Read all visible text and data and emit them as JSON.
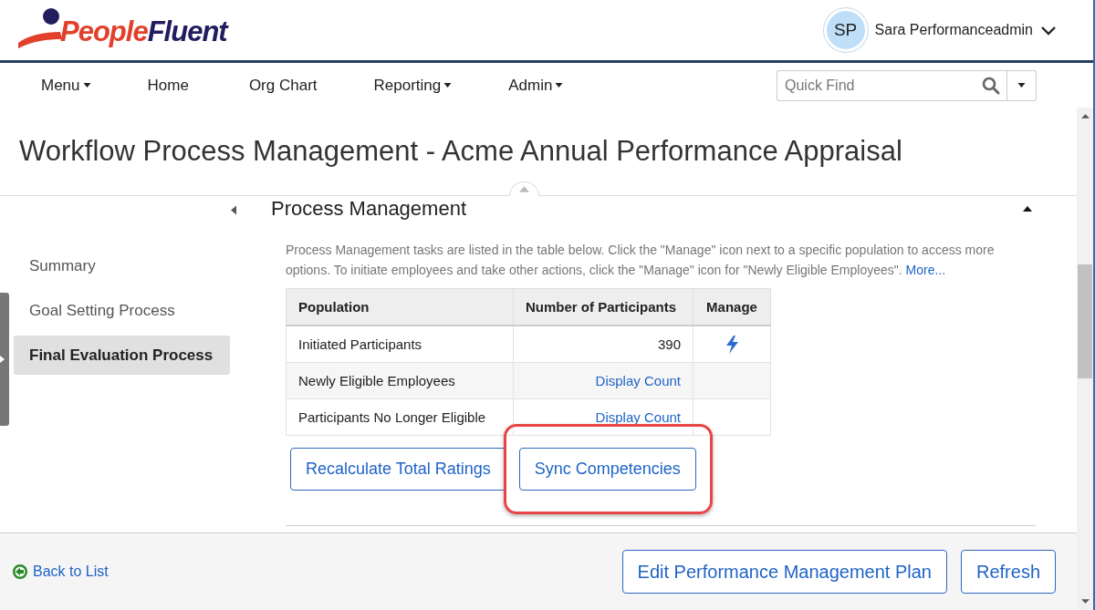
{
  "header": {
    "logo": {
      "part_1": "People",
      "part_2": "Fluent"
    },
    "user": {
      "initials": "SP",
      "name": "Sara Performanceadmin"
    }
  },
  "nav": {
    "items": [
      {
        "label": "Menu",
        "dropdown": true
      },
      {
        "label": "Home",
        "dropdown": false
      },
      {
        "label": "Org Chart",
        "dropdown": false
      },
      {
        "label": "Reporting",
        "dropdown": true
      },
      {
        "label": "Admin",
        "dropdown": true
      }
    ],
    "search": {
      "placeholder": "Quick Find"
    }
  },
  "page_title": "Workflow Process Management - Acme Annual Performance Appraisal",
  "sidebar": {
    "items": [
      {
        "label": "Summary",
        "selected": false
      },
      {
        "label": "Goal Setting Process",
        "selected": false
      },
      {
        "label": "Final Evaluation Process",
        "selected": true
      }
    ]
  },
  "section": {
    "title": "Process Management",
    "expanded": true,
    "description": "Process Management tasks are listed in the table below. Click the \"Manage\" icon next to a specific population to access more options. To initiate employees and take other actions, click the \"Manage\" icon for \"Newly Eligible Employees\".",
    "more_link": "More...",
    "table": {
      "columns": [
        "Population",
        "Number of Participants",
        "Manage"
      ],
      "rows": [
        {
          "population": "Initiated Participants",
          "participants": {
            "kind": "number",
            "text": "390"
          },
          "manage": true
        },
        {
          "population": "Newly Eligible Employees",
          "participants": {
            "kind": "link",
            "text": "Display Count"
          },
          "manage": false
        },
        {
          "population": "Participants No Longer Eligible",
          "participants": {
            "kind": "link",
            "text": "Display Count"
          },
          "manage": false
        }
      ]
    },
    "buttons": [
      {
        "label": "Recalculate Total Ratings",
        "highlighted": false
      },
      {
        "label": "Sync Competencies",
        "highlighted": true
      }
    ]
  },
  "footer": {
    "back_link": "Back to List",
    "buttons": [
      "Edit Performance Management Plan",
      "Refresh"
    ]
  }
}
